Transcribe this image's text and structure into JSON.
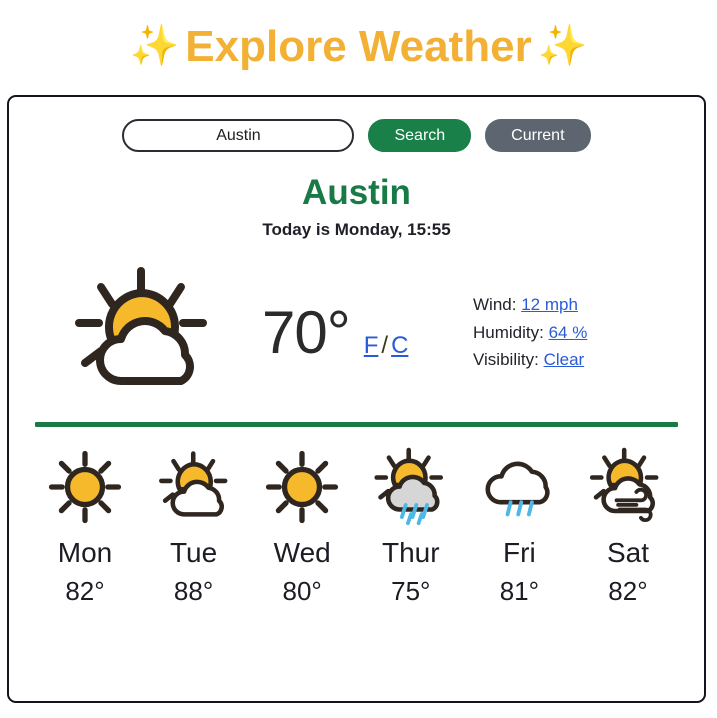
{
  "header": {
    "sparkle_left": "✨",
    "title": "Explore Weather",
    "sparkle_right": "✨"
  },
  "search": {
    "input_value": "Austin",
    "input_placeholder": "Austin",
    "search_label": "Search",
    "current_label": "Current"
  },
  "location": {
    "city": "Austin",
    "today_line": "Today is Monday, 15:55"
  },
  "current": {
    "icon": "sun-behind-cloud-icon",
    "temperature": "70°",
    "unit_f": "F",
    "unit_separator": "/",
    "unit_c": "C",
    "details": [
      {
        "label": "Wind:",
        "value": "12 mph"
      },
      {
        "label": "Humidity:",
        "value": "64 %"
      },
      {
        "label": "Visibility:",
        "value": "Clear"
      }
    ]
  },
  "forecast": [
    {
      "day": "Mon",
      "temp": "82°",
      "icon": "sun-icon"
    },
    {
      "day": "Tue",
      "temp": "88°",
      "icon": "sun-behind-cloud-icon"
    },
    {
      "day": "Wed",
      "temp": "80°",
      "icon": "sun-icon"
    },
    {
      "day": "Thur",
      "temp": "75°",
      "icon": "sun-behind-rain-cloud-icon"
    },
    {
      "day": "Fri",
      "temp": "81°",
      "icon": "rain-cloud-icon"
    },
    {
      "day": "Sat",
      "temp": "82°",
      "icon": "sun-behind-wind-cloud-icon"
    }
  ],
  "colors": {
    "title_gold": "#F2B134",
    "green_accent": "#1a7a46",
    "search_button": "#1a8049",
    "current_button": "#5d6670",
    "link_blue": "#2a5bd7",
    "sun_yellow": "#F5B92B",
    "outline_dark": "#2f2620",
    "rain_blue": "#4db8e8",
    "cloud_gray": "#d6d6d6"
  }
}
